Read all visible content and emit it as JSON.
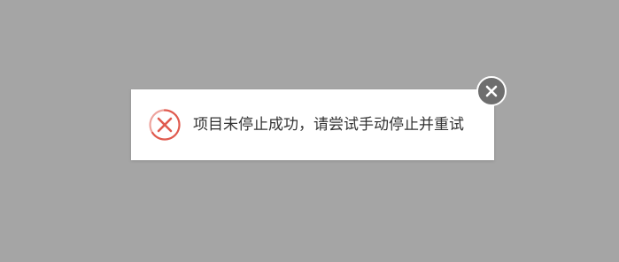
{
  "dialog": {
    "message": "项目未停止成功，请尝试手动停止并重试",
    "icon": "error-circle-x-icon",
    "icon_color": "#e05a4e"
  },
  "close_button": {
    "icon": "close-icon",
    "background_color": "#6e6e6e"
  },
  "overlay_color": "#a5a5a5"
}
